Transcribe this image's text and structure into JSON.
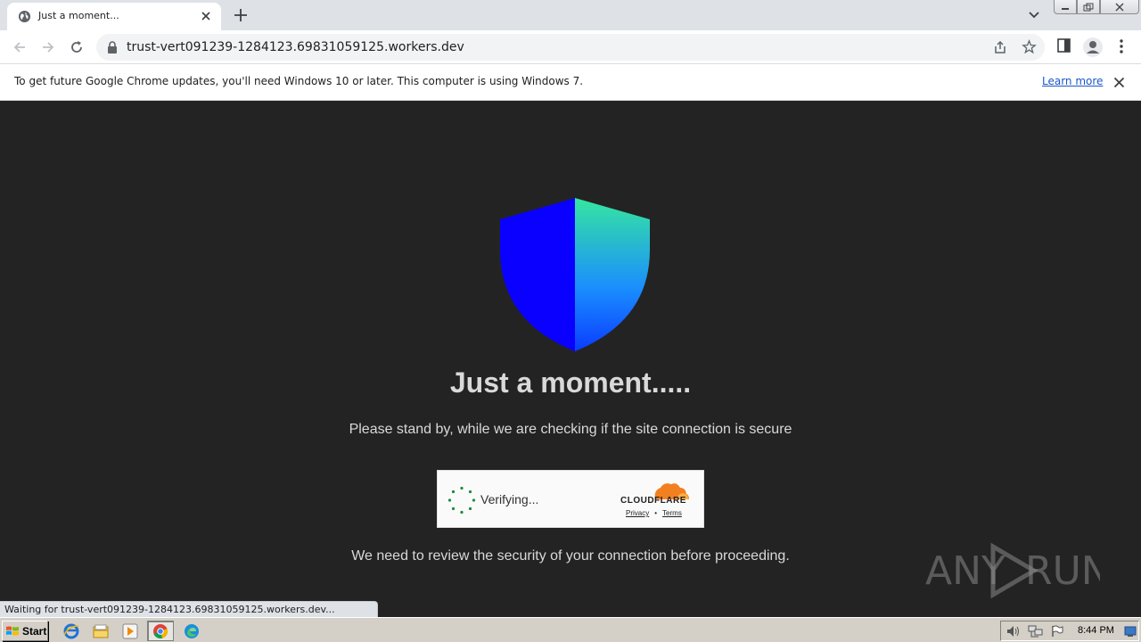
{
  "browser": {
    "tab_title": "Just a moment...",
    "url": "trust-vert091239-1284123.69831059125.workers.dev"
  },
  "infobar": {
    "message": "To get future Google Chrome updates, you'll need Windows 10 or later. This computer is using Windows 7.",
    "learn_more": "Learn more"
  },
  "page": {
    "heading": "Just a moment.....",
    "subtitle": "Please stand by, while we are checking if the site connection is secure",
    "note": "We need to review the security of your connection before proceeding.",
    "shield_colors": {
      "left": "#0a00ff",
      "right_top": "#35e6a0",
      "right_bottom": "#0a3cff"
    }
  },
  "widget": {
    "status": "Verifying...",
    "brand": "CLOUDFLARE",
    "privacy": "Privacy",
    "terms": "Terms",
    "brand_color": "#f38020"
  },
  "status_bar": {
    "text": "Waiting for trust-vert091239-1284123.69831059125.workers.dev..."
  },
  "watermark": {
    "text": "ANY RUN"
  },
  "taskbar": {
    "start_label": "Start",
    "clock": "8:44 PM"
  }
}
